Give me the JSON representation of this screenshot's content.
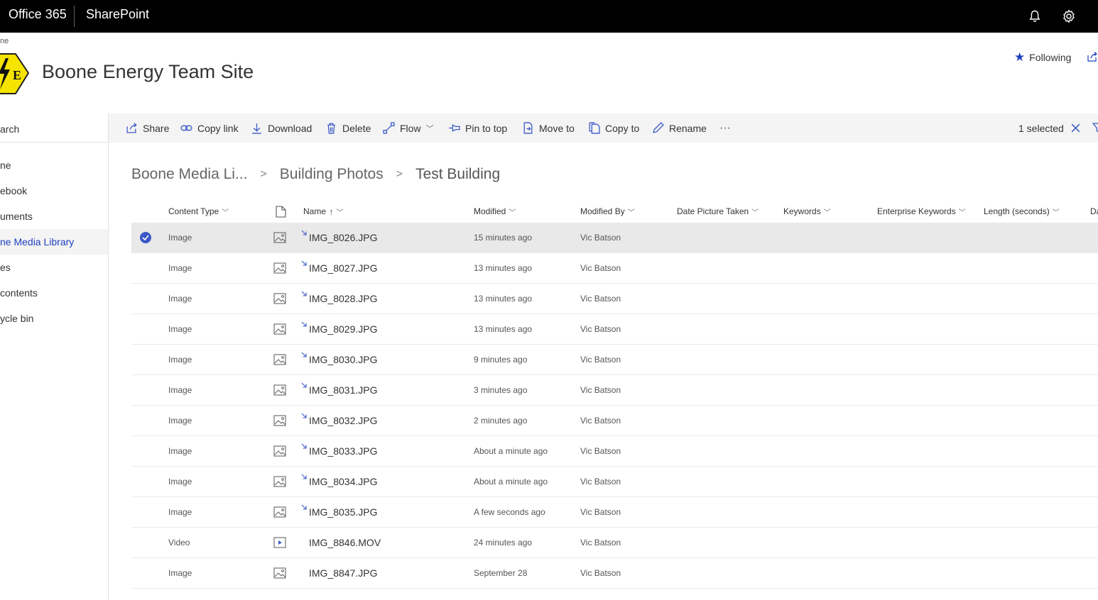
{
  "suite_bar": {
    "app_launcher_label": "Office 365",
    "app_name": "SharePoint"
  },
  "site": {
    "logo_letter": "E",
    "title": "Boone Energy Team Site",
    "top_cut_label": "ne",
    "follow_label": "Following"
  },
  "left_nav": {
    "search_placeholder": "arch",
    "items": [
      {
        "label": "ne"
      },
      {
        "label": "ebook"
      },
      {
        "label": "uments"
      },
      {
        "label": "ne Media Library"
      },
      {
        "label": "es"
      },
      {
        "label": " contents"
      },
      {
        "label": "ycle bin"
      }
    ]
  },
  "command_bar": {
    "share": "Share",
    "copy_link": "Copy link",
    "download": "Download",
    "delete": "Delete",
    "flow": "Flow",
    "pin_to_top": "Pin to top",
    "move_to": "Move to",
    "copy_to": "Copy to",
    "rename": "Rename",
    "more": "···",
    "selected_count": "1 selected"
  },
  "breadcrumb": [
    "Boone Media Li...",
    "Building Photos",
    "Test Building"
  ],
  "columns": {
    "content_type": "Content Type",
    "name": "Name",
    "modified": "Modified",
    "modified_by": "Modified By",
    "date_picture_taken": "Date Picture Taken",
    "keywords": "Keywords",
    "enterprise_keywords": "Enterprise Keywords",
    "length_seconds": "Length (seconds)",
    "cut_column": "Da"
  },
  "rows": [
    {
      "content_type": "Image",
      "file_type": "image",
      "is_new": true,
      "name": "IMG_8026.JPG",
      "modified": "15 minutes ago",
      "modified_by": "Vic Batson",
      "selected": true
    },
    {
      "content_type": "Image",
      "file_type": "image",
      "is_new": true,
      "name": "IMG_8027.JPG",
      "modified": "13 minutes ago",
      "modified_by": "Vic Batson",
      "selected": false
    },
    {
      "content_type": "Image",
      "file_type": "image",
      "is_new": true,
      "name": "IMG_8028.JPG",
      "modified": "13 minutes ago",
      "modified_by": "Vic Batson",
      "selected": false
    },
    {
      "content_type": "Image",
      "file_type": "image",
      "is_new": true,
      "name": "IMG_8029.JPG",
      "modified": "13 minutes ago",
      "modified_by": "Vic Batson",
      "selected": false
    },
    {
      "content_type": "Image",
      "file_type": "image",
      "is_new": true,
      "name": "IMG_8030.JPG",
      "modified": "9 minutes ago",
      "modified_by": "Vic Batson",
      "selected": false
    },
    {
      "content_type": "Image",
      "file_type": "image",
      "is_new": true,
      "name": "IMG_8031.JPG",
      "modified": "3 minutes ago",
      "modified_by": "Vic Batson",
      "selected": false
    },
    {
      "content_type": "Image",
      "file_type": "image",
      "is_new": true,
      "name": "IMG_8032.JPG",
      "modified": "2 minutes ago",
      "modified_by": "Vic Batson",
      "selected": false
    },
    {
      "content_type": "Image",
      "file_type": "image",
      "is_new": true,
      "name": "IMG_8033.JPG",
      "modified": "About a minute ago",
      "modified_by": "Vic Batson",
      "selected": false
    },
    {
      "content_type": "Image",
      "file_type": "image",
      "is_new": true,
      "name": "IMG_8034.JPG",
      "modified": "About a minute ago",
      "modified_by": "Vic Batson",
      "selected": false
    },
    {
      "content_type": "Image",
      "file_type": "image",
      "is_new": true,
      "name": "IMG_8035.JPG",
      "modified": "A few seconds ago",
      "modified_by": "Vic Batson",
      "selected": false
    },
    {
      "content_type": "Video",
      "file_type": "video",
      "is_new": false,
      "name": "IMG_8846.MOV",
      "modified": "24 minutes ago",
      "modified_by": "Vic Batson",
      "selected": false
    },
    {
      "content_type": "Image",
      "file_type": "image",
      "is_new": false,
      "name": "IMG_8847.JPG",
      "modified": "September 28",
      "modified_by": "Vic Batson",
      "selected": false
    }
  ],
  "colors": {
    "suite_bar": "#000000",
    "accent": "#1f3fbf",
    "selected_row": "#e9e9e9",
    "command_bar": "#f4f4f4",
    "logo_yellow": "#f5e400"
  }
}
